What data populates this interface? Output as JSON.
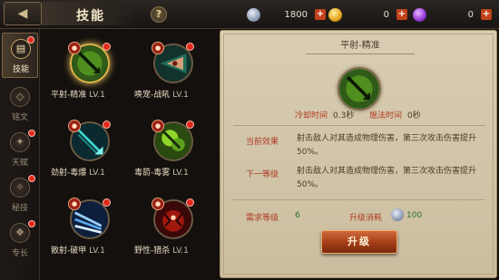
{
  "header": {
    "back_icon": "back-arrow-icon",
    "title": "技能",
    "help_label": "?"
  },
  "currencies": [
    {
      "icon": "silver-coin-icon",
      "value": "1800",
      "add": "+"
    },
    {
      "icon": "gold-coin-icon",
      "value": "0",
      "add": "+"
    },
    {
      "icon": "purple-gem-icon",
      "value": "0",
      "add": "+"
    }
  ],
  "sidebar": {
    "items": [
      {
        "label": "技能",
        "icon": "book-icon",
        "active": true
      },
      {
        "label": "铭文",
        "icon": "rune-icon",
        "active": false
      },
      {
        "label": "天赋",
        "icon": "wings-icon",
        "active": false
      },
      {
        "label": "秘技",
        "icon": "tome-icon",
        "active": false
      },
      {
        "label": "专长",
        "icon": "crest-icon",
        "active": false
      }
    ]
  },
  "skills": [
    {
      "name": "平射-精准",
      "level": "LV.1",
      "selected": true
    },
    {
      "name": "唤宠-战吼",
      "level": "LV.1",
      "selected": false
    },
    {
      "name": "劲射-毒爆",
      "level": "LV.1",
      "selected": false
    },
    {
      "name": "毒箭-毒雾",
      "level": "LV.1",
      "selected": false
    },
    {
      "name": "散射-破甲",
      "level": "LV.1",
      "selected": false
    },
    {
      "name": "野性-猎杀",
      "level": "LV.1",
      "selected": false
    }
  ],
  "detail": {
    "title": "平射-精准",
    "cooldown_label": "冷却时间",
    "cooldown_value": "0.3秒",
    "cast_label": "施法时间",
    "cast_value": "0秒",
    "current_label": "当前效果",
    "current_text": "射击敌人对其造成物理伤害，第三次攻击伤害提升50%。",
    "next_label": "下一等级",
    "next_text": "射击敌人对其造成物理伤害，第三次攻击伤害提升50%。",
    "req_level_label": "需求等级",
    "req_level_value": "6",
    "cost_label": "升级消耗",
    "cost_value": "100",
    "upgrade_label": "升级"
  },
  "colors": {
    "accent_red": "#b03a22",
    "green_value": "#2f6e2f",
    "upgrade_button": "#a33d17",
    "notification_dot": "#e0291b"
  }
}
